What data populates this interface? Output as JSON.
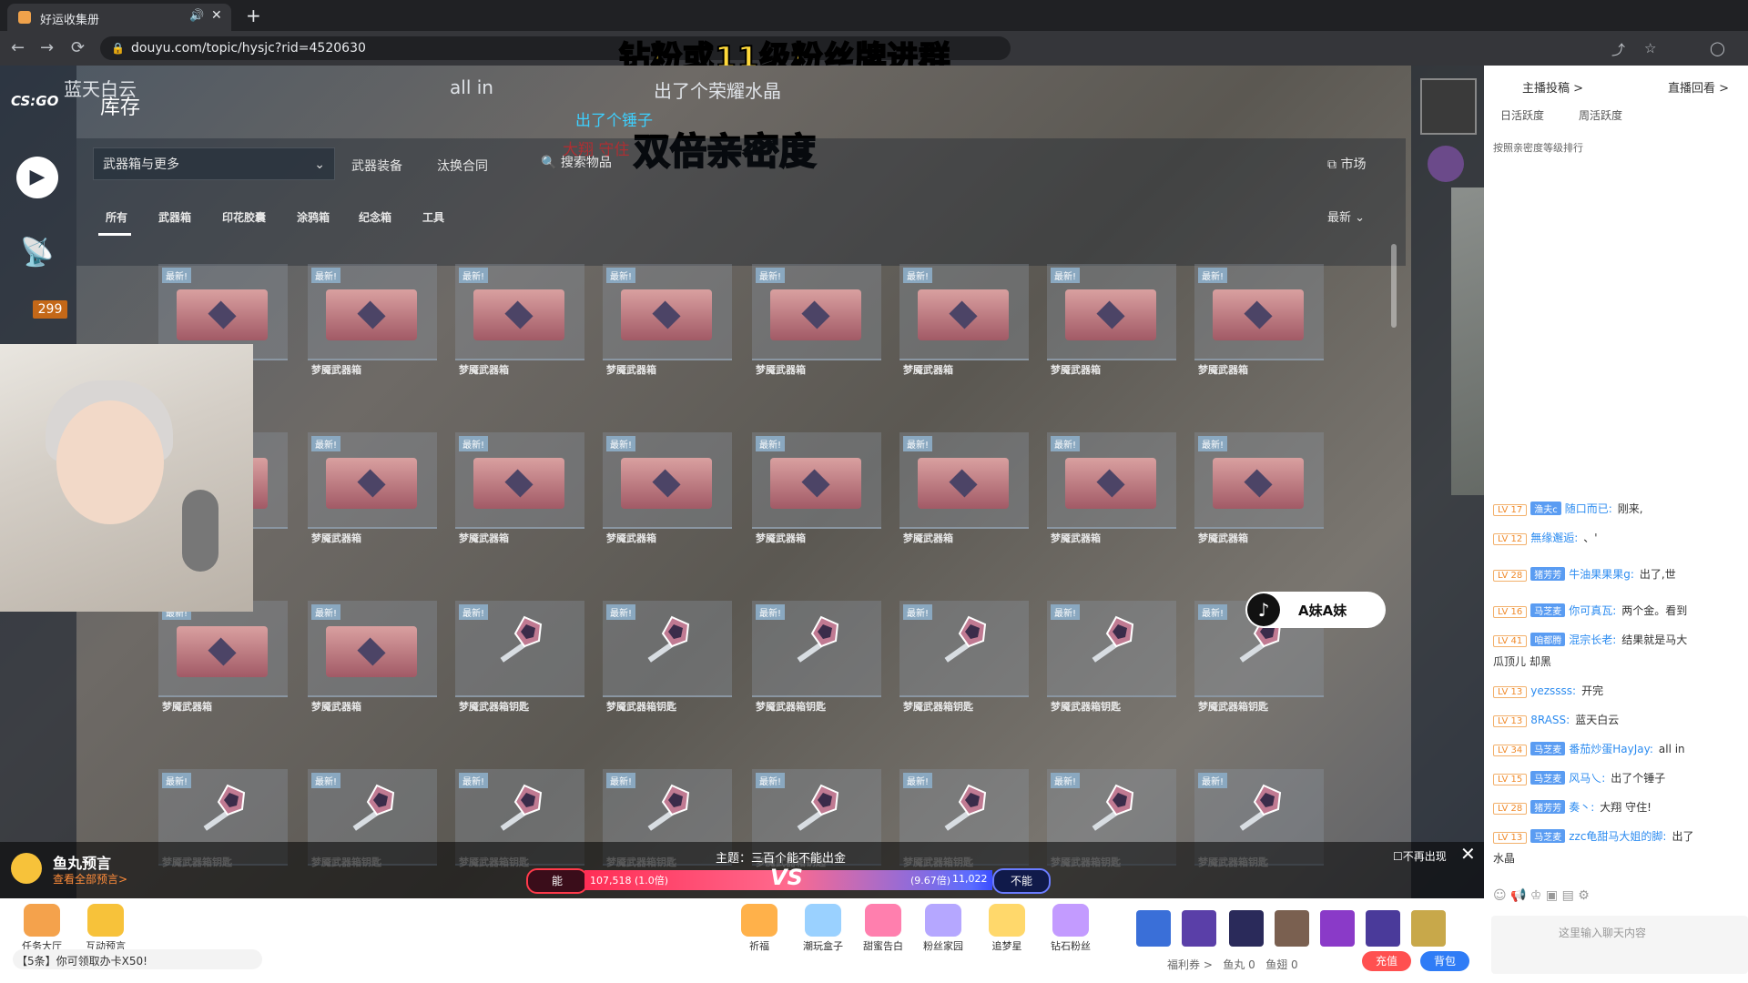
{
  "browser": {
    "tab_title": "好运收集册",
    "new_tab": "+",
    "url": "douyu.com/topic/hysjc?rid=4520630",
    "nav": {
      "back": "←",
      "forward": "→",
      "reload": "⟳"
    }
  },
  "overlay": {
    "top_banner": "钻粉或11级粉丝牌进群",
    "owner": "蓝天白云",
    "all_in": "all in",
    "crystal": "出了个荣耀水晶",
    "hammer": "出了个锤子",
    "guard": "大翔 守住",
    "double": "双倍亲密度"
  },
  "game": {
    "logo": "CS:GO",
    "inventory_title": "库存",
    "badge": "299",
    "dropdown": "武器箱与更多",
    "nav": [
      "武器装备",
      "汰换合同"
    ],
    "search": "搜索物品",
    "market": "市场",
    "subtabs": [
      "所有",
      "武器箱",
      "印花胶囊",
      "涂鸦箱",
      "纪念箱",
      "工具"
    ],
    "sort": "最新",
    "new_tag": "最新!",
    "items_row1": [
      "梦魇武器箱",
      "梦魇武器箱",
      "梦魇武器箱",
      "梦魇武器箱",
      "梦魇武器箱",
      "梦魇武器箱",
      "梦魇武器箱",
      "梦魇武器箱"
    ],
    "items_row2": [
      "梦魇武器箱",
      "梦魇武器箱",
      "梦魇武器箱",
      "梦魇武器箱",
      "梦魇武器箱",
      "梦魇武器箱",
      "梦魇武器箱",
      "梦魇武器箱"
    ],
    "items_row3": [
      "梦魇武器箱",
      "梦魇武器箱",
      "梦魇武器箱钥匙",
      "梦魇武器箱钥匙",
      "梦魇武器箱钥匙",
      "梦魇武器箱钥匙",
      "梦魇武器箱钥匙",
      "梦魇武器箱钥匙"
    ],
    "items_row4": [
      "梦魇武器箱钥匙",
      "梦魇武器箱钥匙",
      "梦魇武器箱钥匙",
      "梦魇武器箱钥匙",
      "梦魇武器箱钥匙",
      "梦魇武器箱钥匙",
      "梦魇武器箱钥匙",
      "梦魇武器箱钥匙"
    ]
  },
  "tiktok": {
    "name": "A妹A妹"
  },
  "pk": {
    "yugan_title": "鱼丸预言",
    "yugan_sub": "查看全部预言>",
    "topic": "主题：三百个能不能出金",
    "left_label": "能",
    "left_value": "107,518 (1.0倍)",
    "vs": "VS",
    "right_rate": "(9.67倍)",
    "right_value": "11,022",
    "right_label": "不能",
    "no_show": "☐不再出现",
    "close": "✕"
  },
  "bottombar": {
    "tools": [
      "任务大厅",
      "互动预言"
    ],
    "gifts": [
      "祈福",
      "潮玩盒子",
      "甜蜜告白",
      "粉丝家园",
      "追梦星",
      "钻石粉丝"
    ],
    "tip": "【5条】你可领取办卡X50!",
    "welfare": "福利券 >",
    "fishball": "鱼丸 0",
    "fishwing": "鱼翅 0",
    "recharge": "充值",
    "backpack": "背包"
  },
  "chat": {
    "contrib": "主播投稿 >",
    "replay": "直播回看 >",
    "tabs": [
      "日活跃度",
      "周活跃度"
    ],
    "rank_desc": "按照亲密度等级排行",
    "messages": [
      {
        "lv": "LV 17",
        "medal": "渔夫c",
        "user": "随口而已:",
        "text": "刚来,"
      },
      {
        "lv": "LV 12",
        "medal": "",
        "user": "無缘邂逅:",
        "text": "、'"
      },
      {
        "lv": "LV 28",
        "medal": "猪芳芳",
        "user": "牛油果果果g:",
        "text": "出了,世"
      },
      {
        "lv": "LV 16",
        "medal": "马芝麦",
        "user": "你可真瓦:",
        "text": "两个金。看到"
      },
      {
        "lv": "LV 41",
        "medal": "咱都腾",
        "user": "混宗长老:",
        "text": "结果就是马大"
      },
      {
        "lv": "",
        "medal": "",
        "user": "",
        "text": "瓜顶儿 却黑"
      },
      {
        "lv": "LV 13",
        "medal": "",
        "user": "yezssss:",
        "text": "开完"
      },
      {
        "lv": "LV 13",
        "medal": "",
        "user": "8RASS:",
        "text": "蓝天白云"
      },
      {
        "lv": "LV 34",
        "medal": "马芝麦",
        "user": "番茄炒蛋HayJay:",
        "text": "all in"
      },
      {
        "lv": "LV 15",
        "medal": "马芝麦",
        "user": "风马乀:",
        "text": "出了个锤子"
      },
      {
        "lv": "LV 28",
        "medal": "猪芳芳",
        "user": "奏丶:",
        "text": "大翔 守住!"
      },
      {
        "lv": "LV 13",
        "medal": "马芝麦",
        "user": "zzc龟甜马大姐的脚:",
        "text": "出了"
      },
      {
        "lv": "",
        "medal": "",
        "user": "",
        "text": "水晶"
      }
    ],
    "input_placeholder": "这里输入聊天内容",
    "self_medal": "猪芳芳"
  }
}
